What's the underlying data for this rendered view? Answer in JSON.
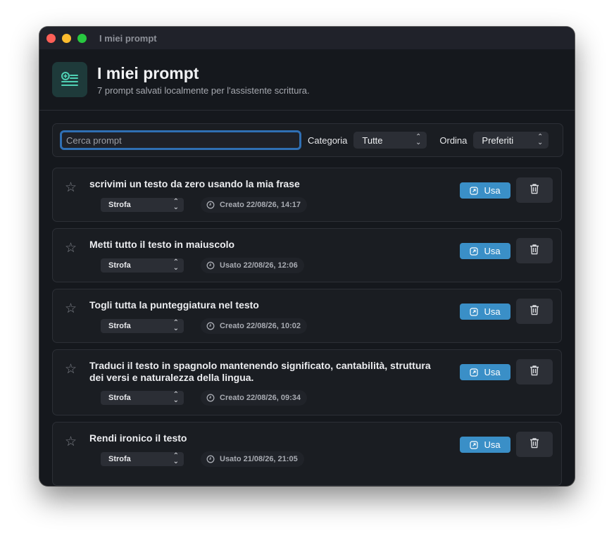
{
  "window": {
    "title": "I miei prompt"
  },
  "header": {
    "title": "I miei prompt",
    "subtitle": "7 prompt salvati localmente per l'assistente scrittura."
  },
  "toolbar": {
    "search_placeholder": "Cerca prompt",
    "search_value": "",
    "category_label": "Categoria",
    "category_value": "Tutte",
    "sort_label": "Ordina",
    "sort_value": "Preferiti"
  },
  "colors": {
    "accent": "#3a8fc7",
    "window_bg": "#15181d",
    "card_bg": "#1a1d22",
    "focus_ring": "#2f6fb4"
  },
  "use_label": "Usa",
  "prompts": [
    {
      "title": "scrivimi un testo da zero usando la mia frase",
      "category": "Strofa",
      "date": "Creato 22/08/26, 14:17",
      "favorite": false
    },
    {
      "title": "Metti tutto il testo in maiuscolo",
      "category": "Strofa",
      "date": "Usato 22/08/26, 12:06",
      "favorite": false
    },
    {
      "title": "Togli tutta la punteggiatura nel testo",
      "category": "Strofa",
      "date": "Creato 22/08/26, 10:02",
      "favorite": false
    },
    {
      "title": "Traduci il testo in spagnolo mantenendo significato, cantabilità, struttura dei versi e naturalezza della lingua.",
      "category": "Strofa",
      "date": "Creato 22/08/26, 09:34",
      "favorite": false
    },
    {
      "title": "Rendi ironico il testo",
      "category": "Strofa",
      "date": "Usato 21/08/26, 21:05",
      "favorite": false
    }
  ]
}
